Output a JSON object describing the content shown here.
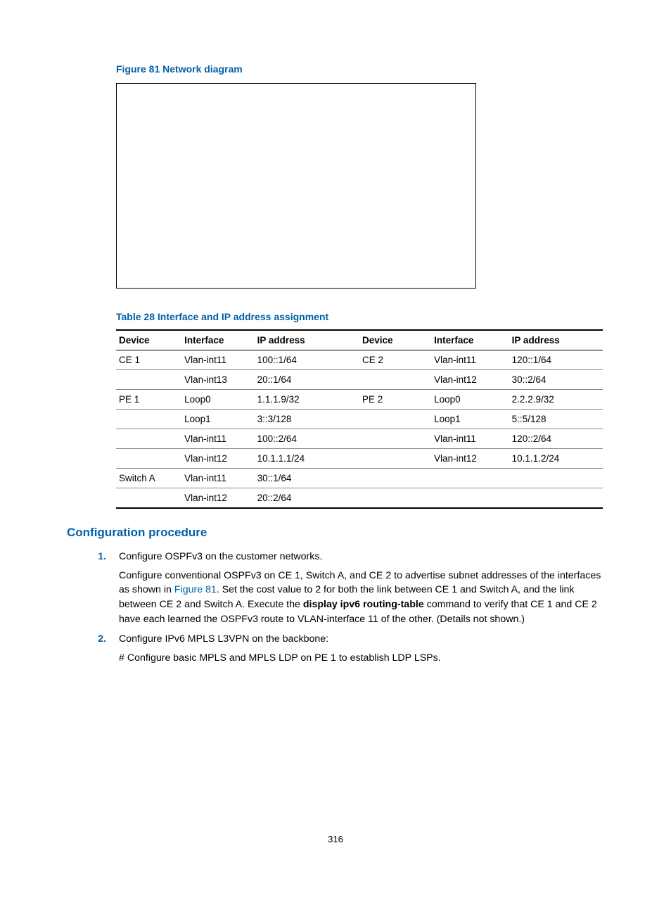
{
  "figure": {
    "caption": "Figure 81 Network diagram"
  },
  "table": {
    "caption": "Table 28 Interface and IP address assignment",
    "headers": [
      "Device",
      "Interface",
      "IP address",
      "Device",
      "Interface",
      "IP address"
    ],
    "rows": [
      [
        "CE 1",
        "Vlan-int11",
        "100::1/64",
        "CE 2",
        "Vlan-int11",
        "120::1/64"
      ],
      [
        "",
        "Vlan-int13",
        "20::1/64",
        "",
        "Vlan-int12",
        "30::2/64"
      ],
      [
        "PE 1",
        "Loop0",
        "1.1.1.9/32",
        "PE 2",
        "Loop0",
        "2.2.2.9/32"
      ],
      [
        "",
        "Loop1",
        "3::3/128",
        "",
        "Loop1",
        "5::5/128"
      ],
      [
        "",
        "Vlan-int11",
        "100::2/64",
        "",
        "Vlan-int11",
        "120::2/64"
      ],
      [
        "",
        "Vlan-int12",
        "10.1.1.1/24",
        "",
        "Vlan-int12",
        "10.1.1.2/24"
      ],
      [
        "Switch A",
        "Vlan-int11",
        "30::1/64",
        "",
        "",
        ""
      ],
      [
        "",
        "Vlan-int12",
        "20::2/64",
        "",
        "",
        ""
      ]
    ]
  },
  "section": {
    "heading": "Configuration procedure",
    "step1": {
      "title": "Configure OSPFv3 on the customer networks.",
      "para_pre": "Configure conventional OSPFv3 on CE 1, Switch A, and CE 2 to advertise subnet addresses of the interfaces as shown in ",
      "link": "Figure 81",
      "para_mid": ". Set the cost value to 2 for both the link between CE 1 and Switch A, and the link between CE 2 and Switch A. Execute the ",
      "cmd": "display ipv6 routing-table",
      "para_post": " command to verify that CE 1 and CE 2 have each learned the OSPFv3 route to VLAN-interface 11 of the other. (Details not shown.)"
    },
    "step2": {
      "title": "Configure IPv6 MPLS L3VPN on the backbone:",
      "line": "# Configure basic MPLS and MPLS LDP on PE 1 to establish LDP LSPs."
    }
  },
  "page_number": "316"
}
